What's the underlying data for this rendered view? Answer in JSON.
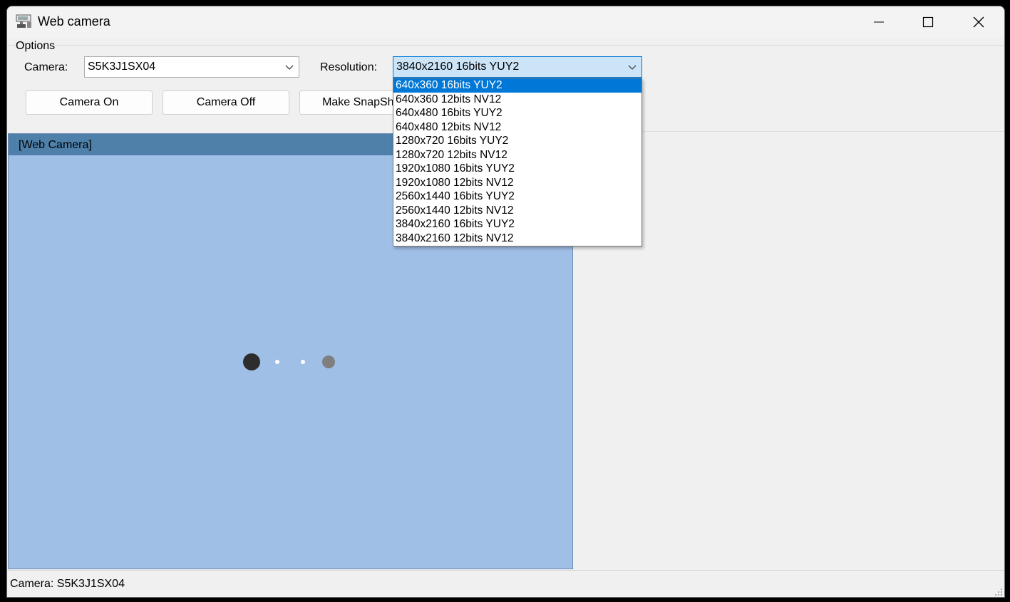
{
  "window": {
    "title": "Web camera",
    "icon": "webcam-app-icon"
  },
  "options": {
    "group_label": "Options",
    "camera_label": "Camera:",
    "camera_value": "S5K3J1SX04",
    "resolution_label": "Resolution:",
    "resolution_value": "3840x2160 16bits YUY2"
  },
  "buttons": {
    "camera_on": "Camera On",
    "camera_off": "Camera Off",
    "make_snapshot": "Make SnapShot"
  },
  "preview": {
    "header": "[Web Camera]"
  },
  "resolution_options": [
    "640x360 16bits YUY2",
    "640x360 12bits NV12",
    "640x480 16bits YUY2",
    "640x480 12bits NV12",
    "1280x720 16bits YUY2",
    "1280x720 12bits NV12",
    "1920x1080 16bits YUY2",
    "1920x1080 12bits NV12",
    "2560x1440 16bits YUY2",
    "2560x1440 12bits NV12",
    "3840x2160 16bits YUY2",
    "3840x2160 12bits NV12"
  ],
  "status": {
    "text": "Camera: S5K3J1SX04"
  },
  "colors": {
    "accent": "#0078d7",
    "preview_bg": "#a0bfe7",
    "preview_header": "#4e80aa"
  }
}
